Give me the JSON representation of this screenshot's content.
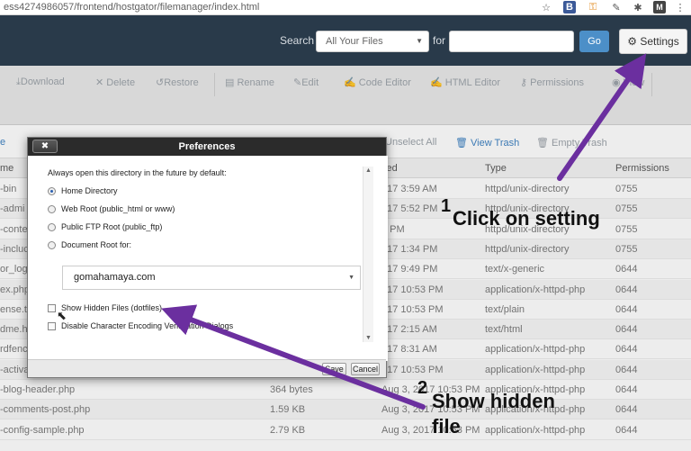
{
  "browser": {
    "url": "ess4274986057/frontend/hostgator/filemanager/index.html",
    "icons": [
      "star-icon",
      "b-extension-icon",
      "key-extension-icon",
      "eyedropper-extension-icon",
      "puzzle-extension-icon",
      "mail-extension-icon",
      "menu-icon"
    ]
  },
  "header": {
    "search_label": "Search",
    "search_scope": "All Your Files",
    "for_label": "for",
    "search_placeholder": "",
    "go_label": "Go",
    "settings_label": "Settings"
  },
  "toolbar": {
    "download": "Download",
    "delete": "Delete",
    "restore": "Restore",
    "rename": "Rename",
    "edit": "Edit",
    "code_editor": "Code Editor",
    "html_editor": "HTML Editor",
    "permissions": "Permissions",
    "view": "View"
  },
  "subbar": {
    "left_partial": "e",
    "unselect_all": "Unselect All",
    "view_trash": "View Trash",
    "empty_trash": "Empty Trash"
  },
  "table": {
    "headers": {
      "name": "me",
      "size": "",
      "modified": "fied",
      "type": "Type",
      "permissions": "Permissions"
    },
    "rows": [
      {
        "name": "-bin",
        "size": "",
        "modified": "017 3:59 AM",
        "type": "httpd/unix-directory",
        "perm": "0755"
      },
      {
        "name": "-admi",
        "size": "",
        "modified": "017 5:52 PM",
        "type": "httpd/unix-directory",
        "perm": "0755"
      },
      {
        "name": "-conte",
        "size": "",
        "modified": "5 PM",
        "type": "httpd/unix-directory",
        "perm": "0755"
      },
      {
        "name": "-incluc",
        "size": "",
        "modified": "017 1:34 PM",
        "type": "httpd/unix-directory",
        "perm": "0755"
      },
      {
        "name": "or_log",
        "size": "",
        "modified": "017 9:49 PM",
        "type": "text/x-generic",
        "perm": "0644"
      },
      {
        "name": "ex.php",
        "size": "",
        "modified": "017 10:53 PM",
        "type": "application/x-httpd-php",
        "perm": "0644"
      },
      {
        "name": "ense.tx",
        "size": "",
        "modified": "017 10:53 PM",
        "type": "text/plain",
        "perm": "0644"
      },
      {
        "name": "dme.h",
        "size": "",
        "modified": "017 2:15 AM",
        "type": "text/html",
        "perm": "0644"
      },
      {
        "name": "rdfenc",
        "size": "",
        "modified": "017 8:31 AM",
        "type": "application/x-httpd-php",
        "perm": "0644"
      },
      {
        "name": "-activa",
        "size": "",
        "modified": "017 10:53 PM",
        "type": "application/x-httpd-php",
        "perm": "0644"
      },
      {
        "name": "-blog-header.php",
        "size": "364 bytes",
        "modified": "Aug 3, 2017 10:53 PM",
        "type": "application/x-httpd-php",
        "perm": "0644"
      },
      {
        "name": "-comments-post.php",
        "size": "1.59 KB",
        "modified": "Aug 3, 2017 10:53 PM",
        "type": "application/x-httpd-php",
        "perm": "0644"
      },
      {
        "name": "-config-sample.php",
        "size": "2.79 KB",
        "modified": "Aug 3, 2017 10:53 PM",
        "type": "application/x-httpd-php",
        "perm": "0644"
      }
    ]
  },
  "dialog": {
    "title": "Preferences",
    "close_label": "✖",
    "intro": "Always open this directory in the future by default:",
    "options": [
      {
        "label": "Home Directory",
        "selected": true
      },
      {
        "label": "Web Root (public_html or www)",
        "selected": false
      },
      {
        "label": "Public FTP Root (public_ftp)",
        "selected": false
      },
      {
        "label": "Document Root for:",
        "selected": false
      }
    ],
    "domain_value": "gomahamaya.com",
    "checkboxes": [
      {
        "label": "Show Hidden Files (dotfiles)",
        "checked": false
      },
      {
        "label": "Disable Character Encoding Verification Dialogs",
        "checked": false
      }
    ],
    "save_label": "Save",
    "cancel_label": "Cancel"
  },
  "annotations": {
    "step1_number": "1",
    "step1_text": "Click on setting",
    "step2_number": "2",
    "step2_text_line1": "Show hidden",
    "step2_text_line2": "file",
    "arrow_color": "#6b2f9f"
  }
}
